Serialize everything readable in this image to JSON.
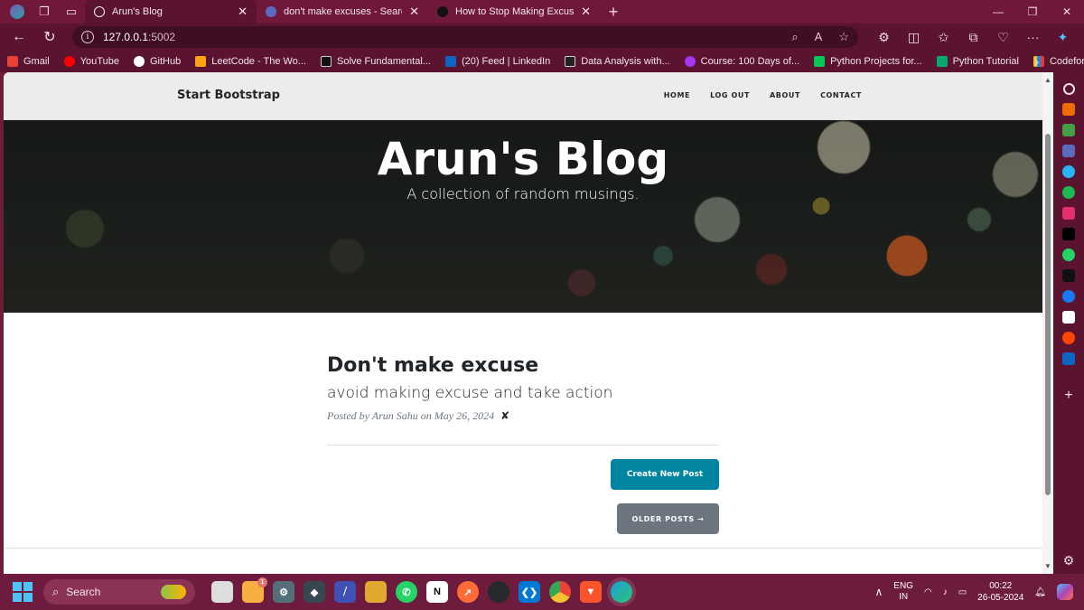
{
  "browser": {
    "tabs": [
      {
        "title": "Arun's Blog",
        "active": true,
        "favicon_color": "#f0f0f0"
      },
      {
        "title": "don't make excuses - Search",
        "active": false,
        "favicon_color": "#5c6bc0"
      },
      {
        "title": "How to Stop Making Excuses and",
        "active": false,
        "favicon_color": "#111111"
      }
    ],
    "url_host": "127.0.0.1",
    "url_port": ":5002",
    "bookmarks": [
      {
        "label": "Gmail",
        "color": "#ea4335"
      },
      {
        "label": "YouTube",
        "color": "#ff0000"
      },
      {
        "label": "GitHub",
        "color": "#ffffff"
      },
      {
        "label": "LeetCode - The Wo...",
        "color": "#ffa116"
      },
      {
        "label": "Solve Fundamental...",
        "color": "#111111"
      },
      {
        "label": "(20) Feed | LinkedIn",
        "color": "#0a66c2"
      },
      {
        "label": "Data Analysis with...",
        "color": "#222222"
      },
      {
        "label": "Course: 100 Days of...",
        "color": "#a435f0"
      },
      {
        "label": "Python Projects for...",
        "color": "#00c853"
      },
      {
        "label": "Python Tutorial",
        "color": "#04aa6d"
      },
      {
        "label": "Codeforces",
        "color": "#1e88e5"
      }
    ]
  },
  "site": {
    "brand": "Start Bootstrap",
    "nav": [
      "HOME",
      "LOG OUT",
      "ABOUT",
      "CONTACT"
    ],
    "heading": "Arun's Blog",
    "subheading": "A collection of random musings.",
    "post": {
      "title": "Don't make excuse",
      "subtitle": "avoid making excuse and take action",
      "meta_prefix": "Posted by",
      "author": "Arun Sahu",
      "meta_on": "on",
      "date": "May 26, 2024",
      "delete_glyph": "✘"
    },
    "create_button": "Create New Post",
    "older_button": "OLDER POSTS →"
  },
  "taskbar": {
    "search_placeholder": "Search",
    "lang": "ENG",
    "region": "IN",
    "time": "00:22",
    "date": "26-05-2024",
    "apps": [
      {
        "name": "file-explorer",
        "color": "#e0a82e"
      },
      {
        "name": "whatsapp",
        "color": "#25d366"
      },
      {
        "name": "notion",
        "color": "#ffffff"
      },
      {
        "name": "postman",
        "color": "#ff6c37"
      },
      {
        "name": "github-desktop",
        "color": "#24292e"
      },
      {
        "name": "vscode",
        "color": "#0078d4"
      },
      {
        "name": "chrome",
        "color": "#fbc02d"
      },
      {
        "name": "brave",
        "color": "#fb542b"
      },
      {
        "name": "edge",
        "color": "#1a9fd8"
      }
    ]
  },
  "colors": {
    "accent": "#0085a1",
    "secondary_button": "#6c757d",
    "browser_frame": "#5a1430"
  }
}
